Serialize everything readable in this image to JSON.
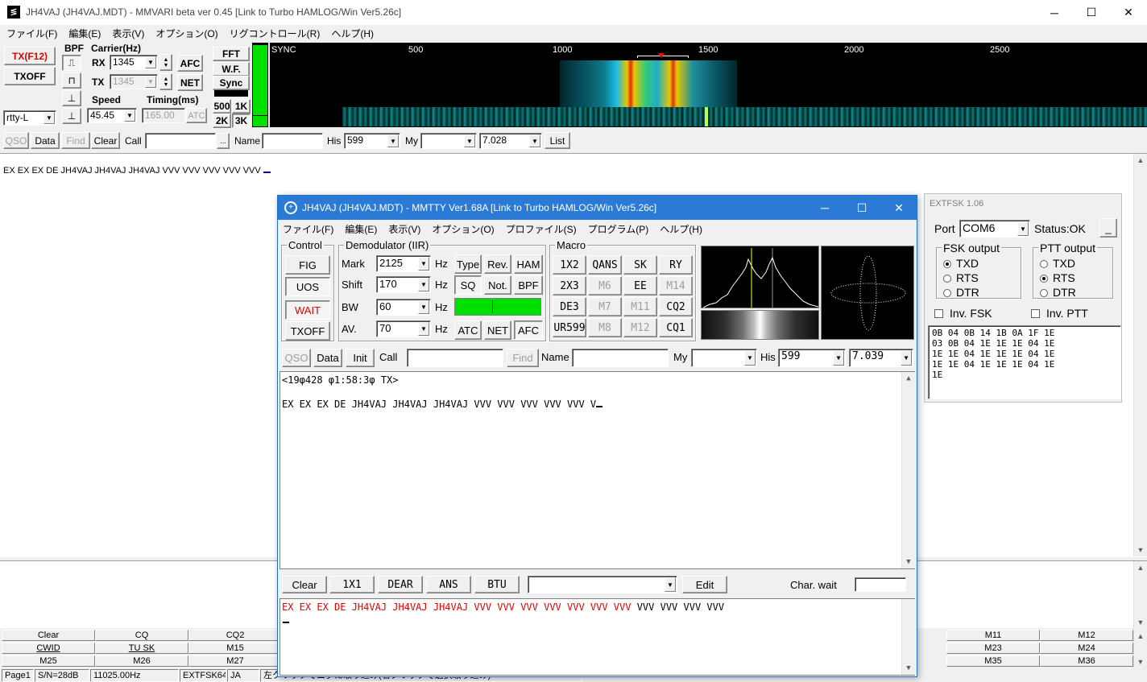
{
  "main": {
    "title": "JH4VAJ (JH4VAJ.MDT) - MMVARI beta ver 0.45 [Link to Turbo HAMLOG/Win Ver5.26c]",
    "menu": [
      "ファイル(F)",
      "編集(E)",
      "表示(V)",
      "オプション(O)",
      "リグコントロール(R)",
      "ヘルプ(H)"
    ],
    "tx_button": "TX(F12)",
    "txoff_button": "TXOFF",
    "mode_select": "rtty-L",
    "bpf_label": "BPF",
    "carrier_label": "Carrier(Hz)",
    "rx_label": "RX",
    "rx_value": "1345",
    "tx_label": "TX",
    "tx_value": "1345",
    "afc_button": "AFC",
    "net_button": "NET",
    "speed_label": "Speed",
    "speed_value": "45.45",
    "timing_label": "Timing(ms)",
    "timing_value": "165.00",
    "atc_button": "ATC",
    "fft_button": "FFT",
    "wf_button": "W.F.",
    "sync_button": "Sync",
    "b500": "500",
    "b1k": "1K",
    "b2k": "2K",
    "b3k": "3K",
    "scale": [
      "SYNC",
      "500",
      "1000",
      "1500",
      "2000",
      "2500"
    ],
    "toolbar": {
      "qso": "QSO",
      "data": "Data",
      "find": "Find",
      "clear": "Clear",
      "call_label": "Call",
      "call_value": "",
      "name_label": "Name",
      "name_value": "",
      "his_label": "His",
      "his_value": "599",
      "my_label": "My",
      "my_value": "",
      "freq_value": "7.028",
      "list": "List"
    },
    "rx_text": "EX EX EX DE JH4VAJ JH4VAJ JH4VAJ VVV VVV VVV VVV VVV",
    "fn_row1": [
      "Clear",
      "CQ",
      "CQ2",
      "M11",
      "M12"
    ],
    "fn_row2": [
      "CWID",
      "TU SK",
      "M15",
      "M23",
      "M24"
    ],
    "fn_row3": [
      "M25",
      "M26",
      "M27",
      "M35",
      "M36"
    ],
    "status": [
      "Page1",
      "S/N=28dB",
      "11025.00Hz",
      "EXTFSK64",
      "JA",
      "左クリックでログに取り込み(右クリックで選択取り込み)"
    ]
  },
  "mmtty": {
    "title": "JH4VAJ (JH4VAJ.MDT) - MMTTY Ver1.68A [Link to Turbo HAMLOG/Win Ver5.26c]",
    "menu": [
      "ファイル(F)",
      "編集(E)",
      "表示(V)",
      "オプション(O)",
      "プロファイル(S)",
      "プログラム(P)",
      "ヘルプ(H)"
    ],
    "control_label": "Control",
    "fig": "FIG",
    "uos": "UOS",
    "wait": "WAIT",
    "txoff": "TXOFF",
    "demod_label": "Demodulator (IIR)",
    "mark_label": "Mark",
    "mark_value": "2125",
    "shift_label": "Shift",
    "shift_value": "170",
    "bw_label": "BW",
    "bw_value": "60",
    "av_label": "AV.",
    "av_value": "70",
    "hz": "Hz",
    "type": "Type",
    "rev": "Rev.",
    "ham": "HAM",
    "sq": "SQ",
    "not": "Not.",
    "bpf": "BPF",
    "atc": "ATC",
    "net": "NET",
    "afc": "AFC",
    "macro_label": "Macro",
    "macros": [
      "1X2",
      "QANS",
      "SK",
      "RY",
      "2X3",
      "M6",
      "EE",
      "M14",
      "DE3",
      "M7",
      "M11",
      "CQ2",
      "UR599",
      "M8",
      "M12",
      "CQ1"
    ],
    "toolbar": {
      "qso": "QSO",
      "data": "Data",
      "init": "Init",
      "call_label": "Call",
      "call_value": "",
      "find": "Find",
      "name_label": "Name",
      "name_value": "",
      "my_label": "My",
      "my_value": "",
      "his_label": "His",
      "his_value": "599",
      "freq_value": "7.039"
    },
    "rx_line1": "<19φ428 φ1:58:3φ TX>",
    "rx_line2": "EX EX EX DE JH4VAJ JH4VAJ JH4VAJ VVV VVV VVV VVV VVV V",
    "tx_bar": {
      "clear": "Clear",
      "b1x1": "1X1",
      "dear": "DEAR",
      "ans": "ANS",
      "btu": "BTU",
      "combo": "",
      "edit": "Edit",
      "charwait": "Char. wait"
    },
    "tx_sent": "EX EX EX DE JH4VAJ JH4VAJ JH4VAJ VVV VVV VVV VVV VVV VVV VVV",
    "tx_pending": " VVV VVV VVV VVV"
  },
  "extfsk": {
    "title": "EXTFSK 1.06",
    "port_label": "Port",
    "port_value": "COM6",
    "status": "Status:OK",
    "minimize": "_",
    "fsk_label": "FSK output",
    "fsk_options": [
      "TXD",
      "RTS",
      "DTR"
    ],
    "ptt_label": "PTT output",
    "ptt_options": [
      "TXD",
      "RTS",
      "DTR"
    ],
    "inv_fsk": "Inv. FSK",
    "inv_ptt": "Inv. PTT",
    "hex": [
      "0B 04 0B 14 1B 0A 1F 1E",
      "03 0B 04 1E 1E 1E 04 1E",
      "1E 1E 04 1E 1E 1E 04 1E",
      "1E 1E 04 1E 1E 1E 04 1E",
      "1E"
    ]
  }
}
